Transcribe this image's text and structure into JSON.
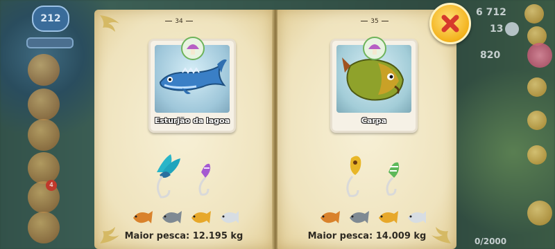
{
  "hud": {
    "level": "212",
    "coins": "6 712",
    "diamonds": "13",
    "xp": "820",
    "storage": "0/2000",
    "notification_count": "4"
  },
  "book": {
    "left_page": {
      "page_number": "34",
      "fish_name": "Esturjão da lagoa",
      "best_catch": "Maior pesca: 12.195 kg",
      "fish_color": "#3a7fc6"
    },
    "right_page": {
      "page_number": "35",
      "fish_name": "Carpa",
      "best_catch": "Maior pesca: 14.009 kg",
      "fish_color": "#8fa22b"
    }
  },
  "trophy_colors": [
    "#d9822b",
    "#7f8a93",
    "#e7a82a",
    "#d7dde3"
  ],
  "close_color": "#d63a2c"
}
